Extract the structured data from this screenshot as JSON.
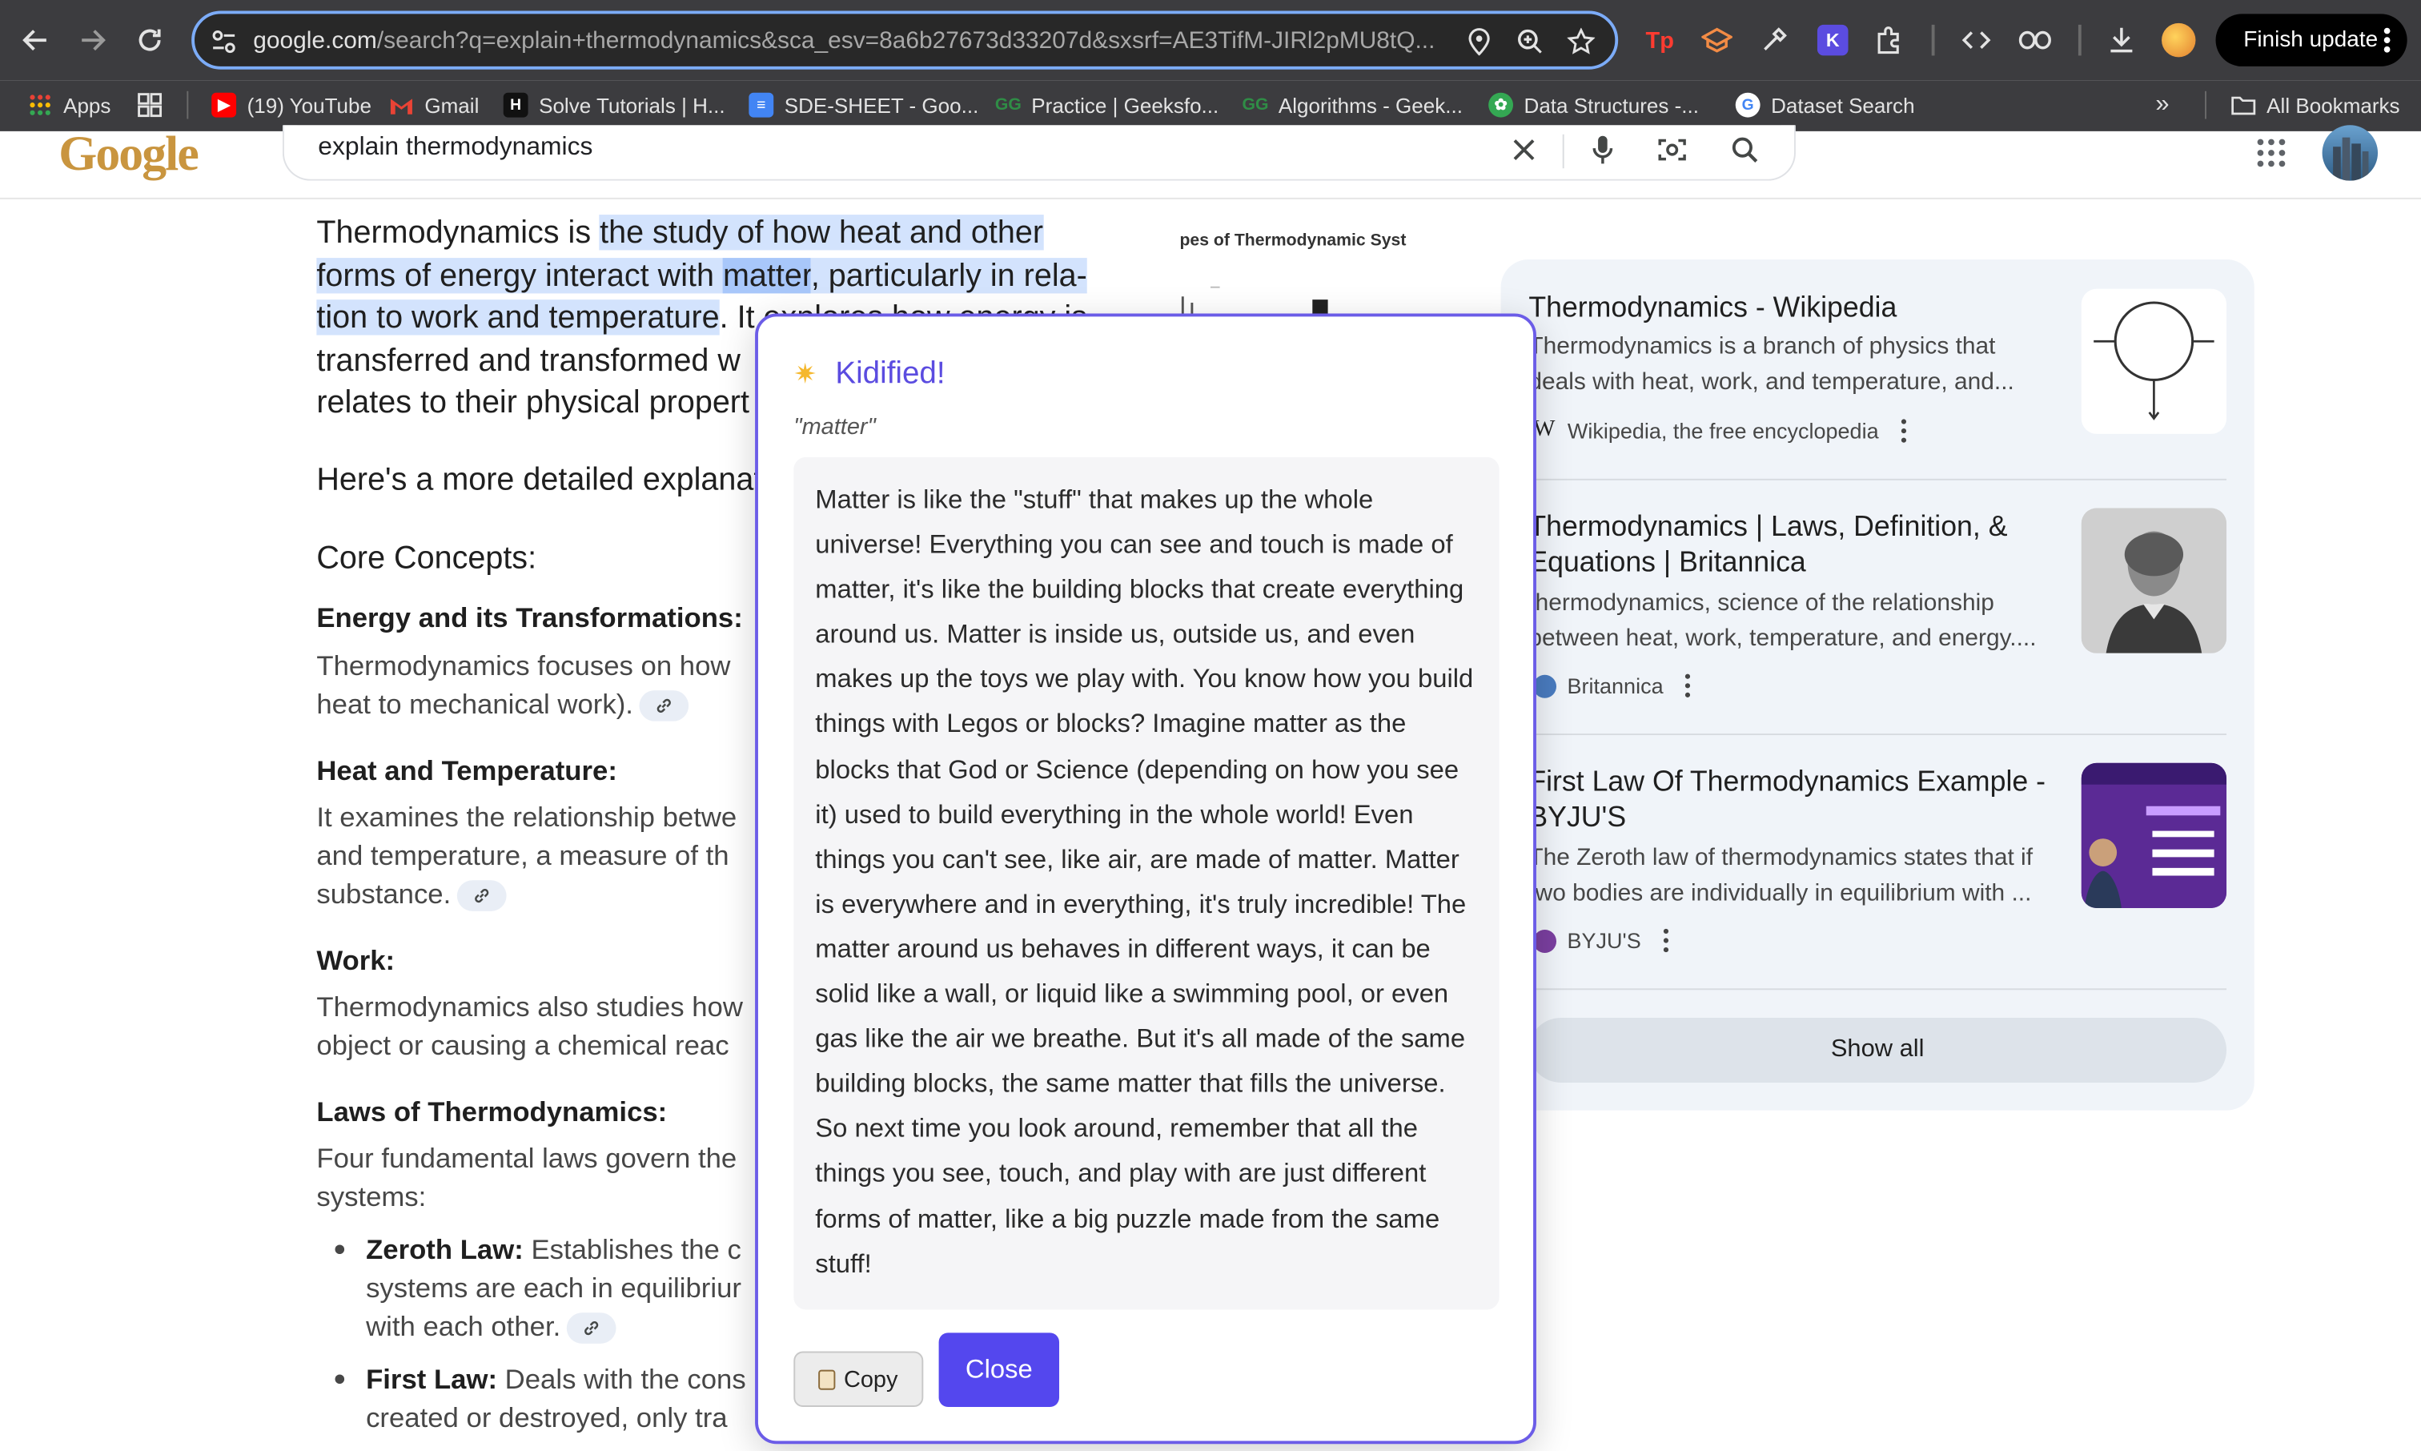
{
  "browser": {
    "url_main": "google.com",
    "url_rest": "/search?q=explain+thermodynamics&sca_esv=8a6b27673d33207d&sxsrf=AE3TifM-JIRl2pMU8tQ...",
    "finish_update_label": "Finish update",
    "bookmarks": [
      {
        "label": "Apps",
        "color": "#e94235"
      },
      {
        "label": "(19) YouTube",
        "color": "#ff0000"
      },
      {
        "label": "Gmail",
        "color": "#ea4335"
      },
      {
        "label": "Solve Tutorials | H...",
        "color": "#111111"
      },
      {
        "label": "SDE-SHEET - Goo...",
        "color": "#4285f4"
      },
      {
        "label": "Practice | Geeksfo...",
        "color": "#2f8d46"
      },
      {
        "label": "Algorithms - Geek...",
        "color": "#2f8d46"
      },
      {
        "label": "Data Structures -...",
        "color": "#34a853"
      },
      {
        "label": "Dataset Search",
        "color": "#4285f4"
      }
    ],
    "all_bookmarks_label": "All Bookmarks"
  },
  "google": {
    "logo_text": "Google",
    "query": "explain thermodynamics"
  },
  "overview": {
    "intro": {
      "part1": "Thermodynamics is ",
      "part2": "the study of how heat and other",
      "part3": "forms of energy interact with ",
      "part4": "matter",
      "part5": ", particularly in rela-",
      "part6": "tion to work and temperature",
      "part7": ". It explores how energy is",
      "line4": "transferred and transformed w",
      "line5": "relates to their physical propert"
    },
    "detailed": "Here's a more detailed explanat",
    "core_concepts": "Core Concepts:",
    "energy_heading": "Energy and its Transformations:",
    "energy_text_1": "Thermodynamics focuses on how",
    "energy_text_2": "heat to mechanical work).",
    "heat_heading": "Heat and Temperature:",
    "heat_text_1": "It examines the relationship betwe",
    "heat_text_2": "and temperature, a measure of th",
    "heat_text_3": "substance.",
    "work_heading": "Work:",
    "work_text_1": "Thermodynamics also studies how",
    "work_text_2": "object or causing a chemical reac",
    "laws_heading": "Laws of Thermodynamics:",
    "laws_text_1": "Four fundamental laws govern the",
    "laws_text_2": "systems:",
    "zeroth_label": "Zeroth Law:",
    "zeroth_text_1": " Establishes the c",
    "zeroth_text_2": "systems are each in equilibriur",
    "zeroth_text_3": "with each other.",
    "first_label": "First Law:",
    "first_text_1": " Deals with the cons",
    "first_text_2": "created or destroyed, only tra",
    "diagram_caption": "pes of Thermodynamic Syst"
  },
  "sources": [
    {
      "title": "Thermodynamics - Wikipedia",
      "snippet_1": "Thermodynamics is a branch of physics that",
      "snippet_2": "deals with heat, work, and temperature, and...",
      "source": "Wikipedia, the free encyclopedia"
    },
    {
      "title_1": "Thermodynamics | Laws, Definition, &",
      "title_2": "Equations | Britannica",
      "snippet_1": "thermodynamics, science of the relationship",
      "snippet_2": "between heat, work, temperature, and energy....",
      "source": "Britannica"
    },
    {
      "title_1": "First Law Of Thermodynamics Example -",
      "title_2": "BYJU'S",
      "snippet_1": "The Zeroth law of thermodynamics states that if",
      "snippet_2": "two bodies are individually in equilibrium with ...",
      "source": "BYJU'S"
    }
  ],
  "show_all_label": "Show all",
  "popup": {
    "title": "Kidified!",
    "term": "\"matter\"",
    "explanation": "Matter is like the \"stuff\" that makes up the whole universe! Everything you can see and touch is made of matter, it's like the building blocks that create everything around us. Matter is inside us, outside us, and even makes up the toys we play with. You know how you build things with Legos or blocks? Imagine matter as the blocks that God or Science (depending on how you see it) used to build everything in the whole world! Even things you can't see, like air, are made of matter. Matter is everywhere and in everything, it's truly incredible! The matter around us behaves in different ways, it can be solid like a wall, or liquid like a swimming pool, or even gas like the air we breathe. But it's all made of the same building blocks, the same matter that fills the universe. So next time you look around, remember that all the things you see, touch, and play with are just different forms of matter, like a big puzzle made from the same stuff!",
    "copy_label": "Copy",
    "close_label": "Close"
  },
  "colors": {
    "accent": "#5447ee",
    "highlight": "#d3e3fd",
    "chrome": "#3c3c3f"
  }
}
